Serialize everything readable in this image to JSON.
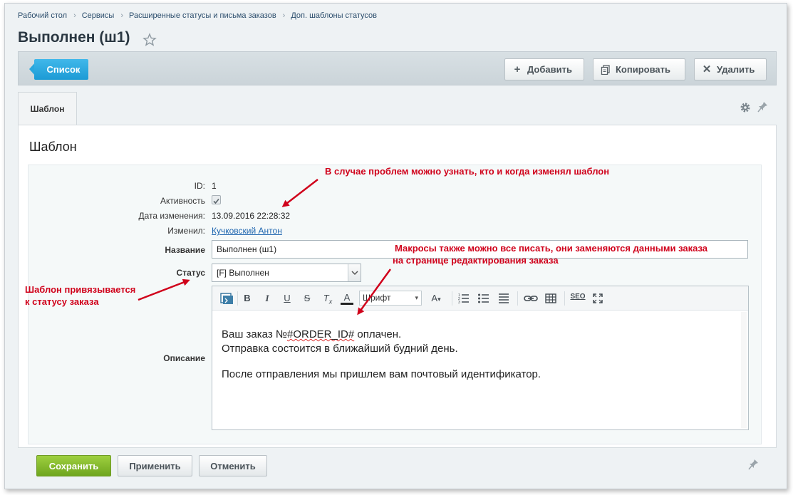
{
  "breadcrumb": [
    "Рабочий стол",
    "Сервисы",
    "Расширенные статусы и письма заказов",
    "Доп. шаблоны статусов"
  ],
  "page": {
    "title": "Выполнен (ш1)"
  },
  "toolbar": {
    "list_label": "Список",
    "add_label": "Добавить",
    "copy_label": "Копировать",
    "delete_label": "Удалить"
  },
  "tabs": [
    {
      "label": "Шаблон",
      "active": true
    }
  ],
  "panel": {
    "title": "Шаблон"
  },
  "form": {
    "id_label": "ID:",
    "id_value": "1",
    "active_label": "Активность",
    "active_checked": true,
    "modified_label": "Дата изменения:",
    "modified_value": "13.09.2016 22:28:32",
    "modified_by_label": "Изменил:",
    "modified_by_value": "Кучковский Антон",
    "name_label": "Название",
    "name_value": "Выполнен (ш1)",
    "status_label": "Статус",
    "status_value": "[F] Выполнен",
    "description_label": "Описание"
  },
  "editor": {
    "toolbar": {
      "bold": "B",
      "italic": "I",
      "underline": "U",
      "strike": "S",
      "clear_format": "T",
      "clear_sub": "x",
      "font_color": "A",
      "font_select": "Шрифт",
      "font_size": "A",
      "seo": "SEO"
    },
    "content": {
      "line1_prefix": "Ваш заказ №",
      "line1_macro": "#ORDER_ID#",
      "line1_suffix": " оплачен.",
      "line2": "Отправка состоится в ближайший будний день.",
      "line3": "После отправления мы пришлем вам почтовый идентификатор."
    }
  },
  "footer": {
    "save_label": "Сохранить",
    "apply_label": "Применить",
    "cancel_label": "Отменить"
  },
  "annotations": {
    "history": "В случае проблем можно узнать, кто и когда изменял шаблон",
    "macros_line1": "Макросы также можно все писать, они заменяются данными заказа",
    "macros_line2": "на странице редактирования заказа",
    "status_line1": "Шаблон привязывается",
    "status_line2": "к статусу заказа"
  },
  "colors": {
    "accent_blue": "#1c9bd5",
    "save_green": "#7cb526",
    "annotation_red": "#d0021b",
    "link_blue": "#2067b0"
  }
}
